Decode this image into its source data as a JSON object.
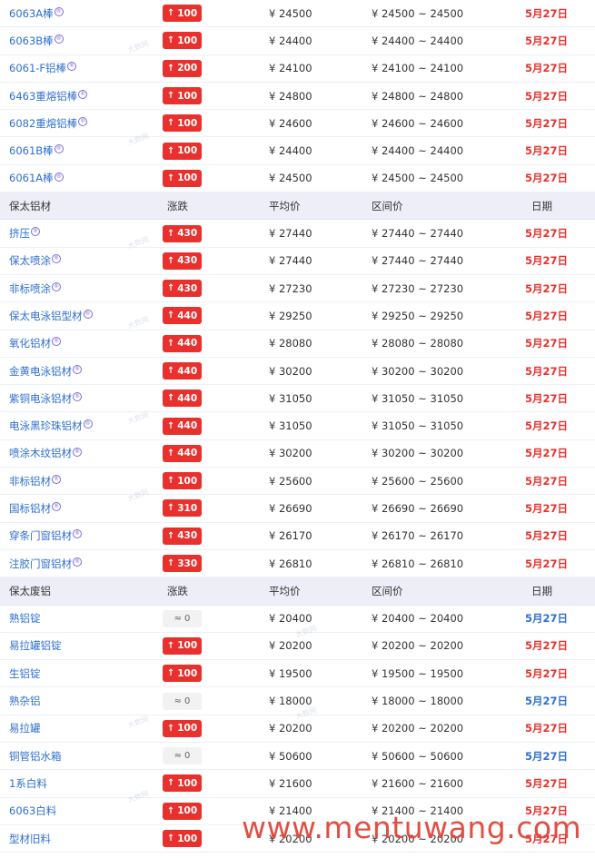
{
  "watermark": "www.mentuwang.com",
  "small_watermark": "大数网",
  "section1": {
    "rows": [
      {
        "name": "6063A棒",
        "change": "100",
        "dir": "up",
        "avg": "¥ 24500",
        "range": "¥ 24500 ~ 24500",
        "date": "5月27日",
        "date_color": "red"
      },
      {
        "name": "6063B棒",
        "change": "100",
        "dir": "up",
        "avg": "¥ 24400",
        "range": "¥ 24400 ~ 24400",
        "date": "5月27日",
        "date_color": "red"
      },
      {
        "name": "6061-F铝棒",
        "change": "200",
        "dir": "up",
        "avg": "¥ 24100",
        "range": "¥ 24100 ~ 24100",
        "date": "5月27日",
        "date_color": "red"
      },
      {
        "name": "6463重熔铝棒",
        "change": "100",
        "dir": "up",
        "avg": "¥ 24800",
        "range": "¥ 24800 ~ 24800",
        "date": "5月27日",
        "date_color": "red"
      },
      {
        "name": "6082重熔铝棒",
        "change": "100",
        "dir": "up",
        "avg": "¥ 24600",
        "range": "¥ 24600 ~ 24600",
        "date": "5月27日",
        "date_color": "red"
      },
      {
        "name": "6061B棒",
        "change": "100",
        "dir": "up",
        "avg": "¥ 24400",
        "range": "¥ 24400 ~ 24400",
        "date": "5月27日",
        "date_color": "red"
      },
      {
        "name": "6061A棒",
        "change": "100",
        "dir": "up",
        "avg": "¥ 24500",
        "range": "¥ 24500 ~ 24500",
        "date": "5月27日",
        "date_color": "red"
      }
    ]
  },
  "section2": {
    "header": {
      "name": "保太铝材",
      "change": "涨跌",
      "avg": "平均价",
      "range": "区间价",
      "date": "日期"
    },
    "rows": [
      {
        "name": "挤压",
        "change": "430",
        "dir": "up",
        "avg": "¥ 27440",
        "range": "¥ 27440 ~ 27440",
        "date": "5月27日",
        "date_color": "red"
      },
      {
        "name": "保太喷涂",
        "change": "430",
        "dir": "up",
        "avg": "¥ 27440",
        "range": "¥ 27440 ~ 27440",
        "date": "5月27日",
        "date_color": "red"
      },
      {
        "name": "非标喷涂",
        "change": "430",
        "dir": "up",
        "avg": "¥ 27230",
        "range": "¥ 27230 ~ 27230",
        "date": "5月27日",
        "date_color": "red"
      },
      {
        "name": "保太电泳铝型材",
        "change": "440",
        "dir": "up",
        "avg": "¥ 29250",
        "range": "¥ 29250 ~ 29250",
        "date": "5月27日",
        "date_color": "red"
      },
      {
        "name": "氧化铝材",
        "change": "440",
        "dir": "up",
        "avg": "¥ 28080",
        "range": "¥ 28080 ~ 28080",
        "date": "5月27日",
        "date_color": "red"
      },
      {
        "name": "金黄电泳铝材",
        "change": "440",
        "dir": "up",
        "avg": "¥ 30200",
        "range": "¥ 30200 ~ 30200",
        "date": "5月27日",
        "date_color": "red"
      },
      {
        "name": "紫铜电泳铝材",
        "change": "440",
        "dir": "up",
        "avg": "¥ 31050",
        "range": "¥ 31050 ~ 31050",
        "date": "5月27日",
        "date_color": "red"
      },
      {
        "name": "电泳黑珍珠铝材",
        "change": "440",
        "dir": "up",
        "avg": "¥ 31050",
        "range": "¥ 31050 ~ 31050",
        "date": "5月27日",
        "date_color": "red"
      },
      {
        "name": "喷涂木纹铝材",
        "change": "440",
        "dir": "up",
        "avg": "¥ 30200",
        "range": "¥ 30200 ~ 30200",
        "date": "5月27日",
        "date_color": "red"
      },
      {
        "name": "非标铝材",
        "change": "100",
        "dir": "up",
        "avg": "¥ 25600",
        "range": "¥ 25600 ~ 25600",
        "date": "5月27日",
        "date_color": "red"
      },
      {
        "name": "国标铝材",
        "change": "310",
        "dir": "up",
        "avg": "¥ 26690",
        "range": "¥ 26690 ~ 26690",
        "date": "5月27日",
        "date_color": "red"
      },
      {
        "name": "穿条门窗铝材",
        "change": "430",
        "dir": "up",
        "avg": "¥ 26170",
        "range": "¥ 26170 ~ 26170",
        "date": "5月27日",
        "date_color": "red"
      },
      {
        "name": "注胶门窗铝材",
        "change": "330",
        "dir": "up",
        "avg": "¥ 26810",
        "range": "¥ 26810 ~ 26810",
        "date": "5月27日",
        "date_color": "red"
      }
    ]
  },
  "section3": {
    "header": {
      "name": "保太废铝",
      "change": "涨跌",
      "avg": "平均价",
      "range": "区间价",
      "date": "日期"
    },
    "rows": [
      {
        "name": "熟铝锭",
        "change": "0",
        "dir": "flat",
        "avg": "¥ 20400",
        "range": "¥ 20400 ~ 20400",
        "date": "5月27日",
        "date_color": "blue"
      },
      {
        "name": "易拉罐铝锭",
        "change": "100",
        "dir": "up",
        "avg": "¥ 20200",
        "range": "¥ 20200 ~ 20200",
        "date": "5月27日",
        "date_color": "red"
      },
      {
        "name": "生铝锭",
        "change": "100",
        "dir": "up",
        "avg": "¥ 19500",
        "range": "¥ 19500 ~ 19500",
        "date": "5月27日",
        "date_color": "red"
      },
      {
        "name": "熟杂铝",
        "change": "0",
        "dir": "flat",
        "avg": "¥ 18000",
        "range": "¥ 18000 ~ 18000",
        "date": "5月27日",
        "date_color": "blue"
      },
      {
        "name": "易拉罐",
        "change": "100",
        "dir": "up",
        "avg": "¥ 20200",
        "range": "¥ 20200 ~ 20200",
        "date": "5月27日",
        "date_color": "red"
      },
      {
        "name": "铜管铝水箱",
        "change": "0",
        "dir": "flat",
        "avg": "¥ 50600",
        "range": "¥ 50600 ~ 50600",
        "date": "5月27日",
        "date_color": "blue"
      },
      {
        "name": "1系白料",
        "change": "100",
        "dir": "up",
        "avg": "¥ 21600",
        "range": "¥ 21600 ~ 21600",
        "date": "5月27日",
        "date_color": "red"
      },
      {
        "name": "6063白料",
        "change": "100",
        "dir": "up",
        "avg": "¥ 21400",
        "range": "¥ 21400 ~ 21400",
        "date": "5月27日",
        "date_color": "red"
      },
      {
        "name": "型材旧料",
        "change": "100",
        "dir": "up",
        "avg": "¥ 20200",
        "range": "¥ 20200 ~ 20200",
        "date": "5月27日",
        "date_color": "red"
      }
    ]
  },
  "reg_marks": {
    "section1": [
      "®",
      "®",
      "®",
      "®",
      "®",
      "®",
      "®"
    ],
    "section2": [
      "®",
      "®",
      "®",
      "®",
      "®",
      "®",
      "®",
      "®",
      "®",
      "®",
      "®",
      "®",
      "®"
    ]
  },
  "badge_glyphs": {
    "up": "↑",
    "flat": "≈"
  },
  "colors": {
    "up_badge": "#e8312d",
    "link": "#2f6fd0",
    "header_bg": "#eeeef8"
  }
}
